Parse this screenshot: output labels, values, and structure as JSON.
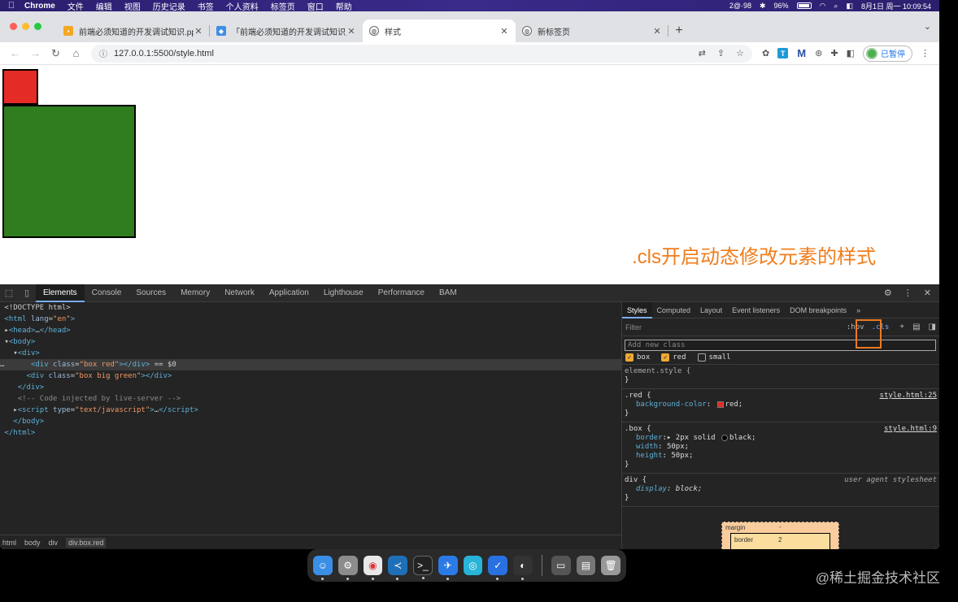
{
  "menubar": {
    "app_name": "Chrome",
    "items": [
      "文件",
      "编辑",
      "视图",
      "历史记录",
      "书签",
      "个人资料",
      "标签页",
      "窗口",
      "帮助"
    ],
    "battery": "96%",
    "status_text": "2@·98",
    "datetime": "8月1日 周一  10:09:54"
  },
  "tabs": [
    {
      "title": "前端必须知道的开发调试知识.pp",
      "favicon_color": "#f5a623"
    },
    {
      "title": "「前端必须知道的开发调试知识」",
      "favicon_color": "#3d8ee8"
    },
    {
      "title": "样式",
      "favicon_color": "#666666"
    },
    {
      "title": "新标签页",
      "favicon_color": "#666666"
    }
  ],
  "address": {
    "url": "127.0.0.1:5500/style.html"
  },
  "profile": {
    "label": "已暂停"
  },
  "page": {
    "caption": ".cls开启动态修改元素的样式",
    "red_box_color": "#e52b25",
    "green_box_color": "#2f7d1f"
  },
  "devtools": {
    "tabs": [
      "Elements",
      "Console",
      "Sources",
      "Memory",
      "Network",
      "Application",
      "Lighthouse",
      "Performance",
      "BAM"
    ],
    "breadcrumb": [
      "html",
      "body",
      "div",
      "div.box.red"
    ],
    "styles_tabs": [
      "Styles",
      "Computed",
      "Layout",
      "Event listeners",
      "DOM breakpoints"
    ],
    "filter_placeholder": "Filter",
    "hov_label": ":hov",
    "cls_label": ".cls",
    "add_class_placeholder": "Add new class",
    "classes": [
      {
        "name": "box",
        "checked": true
      },
      {
        "name": "red",
        "checked": true
      },
      {
        "name": "small",
        "checked": false
      }
    ],
    "rules": {
      "element_style": "element.style {",
      "red_selector": ".red {",
      "red_source": "style.html:25",
      "red_prop": "background-color",
      "red_value": "red;",
      "box_selector": ".box {",
      "box_source": "style.html:9",
      "box_border_prop": "border",
      "box_border_val1": "2px solid ",
      "box_border_val2": "black;",
      "box_width_prop": "width",
      "box_width_val": "50px;",
      "box_height_prop": "height",
      "box_height_val": "50px;",
      "div_selector": "div {",
      "div_source": "user agent stylesheet",
      "div_prop": "display",
      "div_val": "block;"
    },
    "boxmodel": {
      "margin_label": "margin",
      "margin_value": "-",
      "border_label": "border",
      "border_value": "2"
    }
  },
  "watermark": "@稀土掘金技术社区"
}
